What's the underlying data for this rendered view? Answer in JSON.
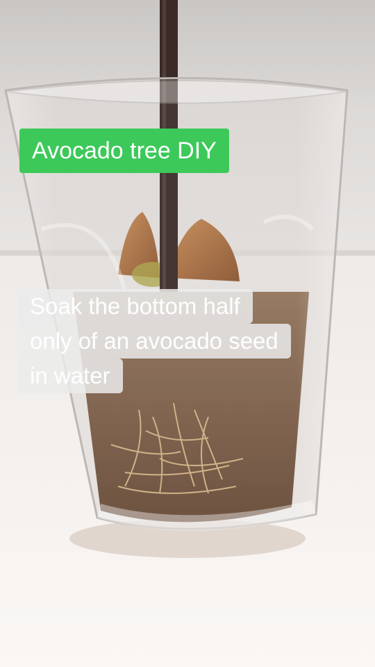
{
  "overlay": {
    "title": "Avocado tree DIY",
    "caption_lines": [
      "Soak the bottom half",
      "only of an avocado seed",
      "in water"
    ]
  },
  "colors": {
    "title_background": "#3cc95a",
    "caption_background": "#ebebeb",
    "text": "#ffffff"
  }
}
